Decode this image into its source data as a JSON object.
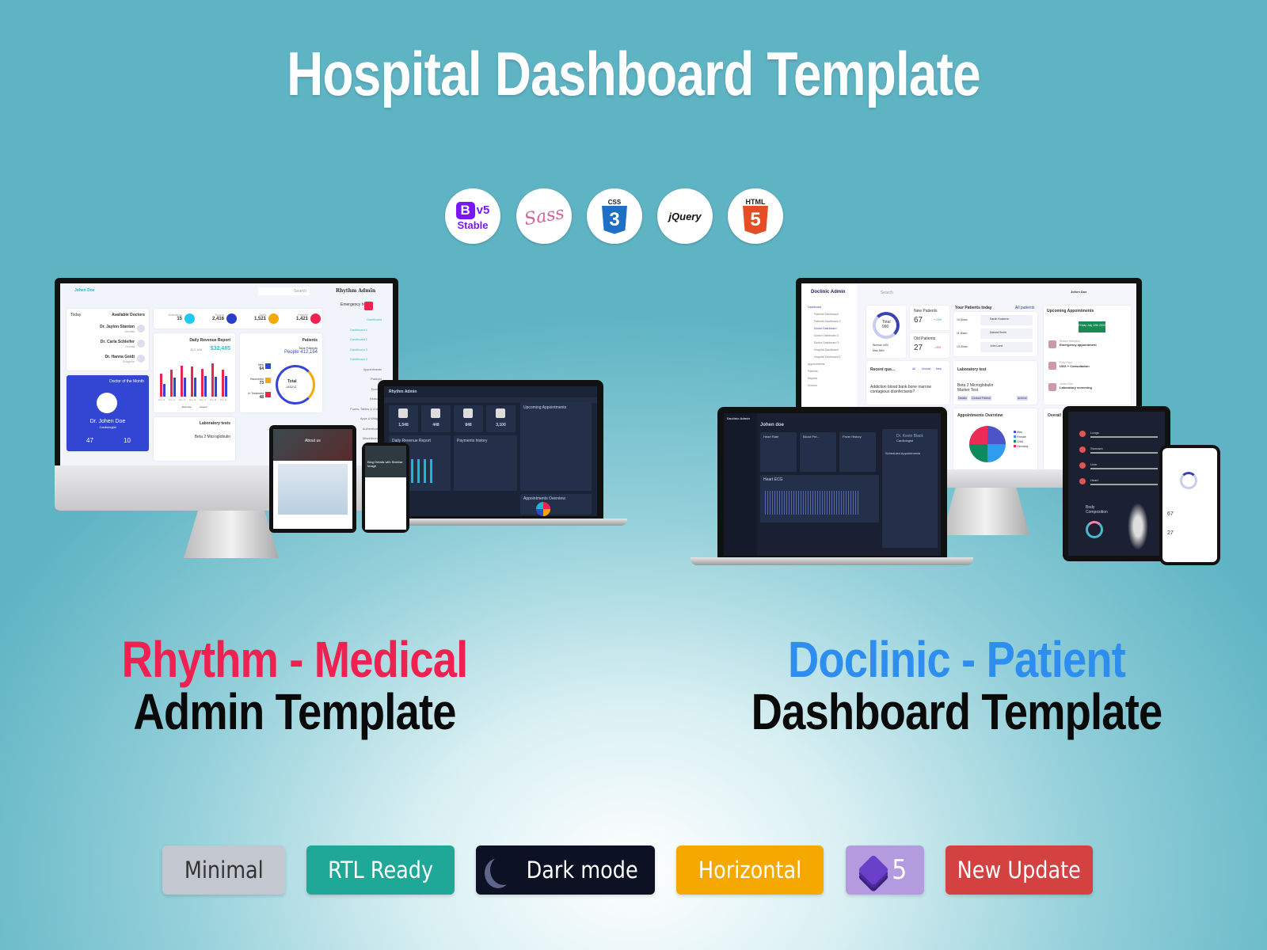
{
  "title": "Hospital Dashboard Template",
  "tech_icons": [
    {
      "name": "bootstrap-icon",
      "label": "B",
      "version": "v5",
      "sub": "Stable",
      "color": "#7a18f5"
    },
    {
      "name": "sass-icon",
      "label": "Sass",
      "color": "#cd6799"
    },
    {
      "name": "css3-icon",
      "label": "CSS",
      "num": "3",
      "color": "#1f6fc5"
    },
    {
      "name": "jquery-icon",
      "label": "jQuery",
      "color": "#0d0d0d"
    },
    {
      "name": "html5-icon",
      "label": "HTML",
      "num": "5",
      "color": "#e54d26"
    }
  ],
  "left_product": {
    "line1": "Rhythm - Medical",
    "line2": "Admin Template",
    "accent": "#ee2150"
  },
  "right_product": {
    "line1": "Doclinic - Patient",
    "line2": "Dashboard Template",
    "accent": "#2d8ef0"
  },
  "rhythm": {
    "brand": "Rhythm Admin",
    "user": "Johen Doe",
    "search": "Search",
    "stats": [
      {
        "label": "Ambulance",
        "value": "15",
        "color": "#1fc8f0"
      },
      {
        "label": "Rooms",
        "value": "2,416",
        "color": "#2a3fc9"
      },
      {
        "label": "Staffs",
        "value": "1,521",
        "color": "#f6a70a"
      },
      {
        "label": "Patients",
        "value": "1,421",
        "color": "#ec2451"
      }
    ],
    "available_doctors": "Available Doctors",
    "today": "Today",
    "doctors": [
      {
        "name": "Dr. Jaylon Stanton",
        "role": "Dentist"
      },
      {
        "name": "Dr. Carla Schleifer",
        "role": "Oculist"
      },
      {
        "name": "Dr. Hanna Geidt",
        "role": "Surgeon"
      }
    ],
    "revenue_title": "Daily Revenue Report",
    "revenue_old": "$12,458",
    "revenue": "$32,485",
    "revenue_days": [
      "May 10",
      "May 11",
      "May 12",
      "May 13",
      "May 14",
      "May 15",
      "May 16"
    ],
    "income": [
      70,
      82,
      92,
      90,
      84,
      100,
      80
    ],
    "expense": [
      38,
      56,
      58,
      57,
      62,
      59,
      63
    ],
    "legend": [
      "Expense",
      "Income"
    ],
    "patients_title": "Patients",
    "total_patients_label": "Total Patients",
    "total_patients": "People 412,154",
    "patient_stats": [
      {
        "label": "New",
        "value": "64"
      },
      {
        "label": "Recovered",
        "value": "73"
      },
      {
        "label": "In Treatment",
        "value": "48"
      }
    ],
    "donut_label": "Total",
    "donut_value": "145212",
    "dotm": "Doctor of the Month",
    "dotm_name": "Dr. Johen Doe",
    "dotm_role": "Cardiologist",
    "dotm_patients": "47",
    "dotm_patients_label": "Patients",
    "dotm_ops": "10",
    "dotm_ops_label": "Operations",
    "lab": "Laboratory tests",
    "lab_item": "Beta 2 Microglobulin",
    "emergency": "Emergency help",
    "menu": [
      "Dashboard",
      "Dashboard 1",
      "Dashboard 2",
      "Dashboard 3",
      "Dashboard 4",
      "Appointments",
      "Patients",
      "Doctors",
      "Features",
      "Forms, Tables & Charts",
      "Apps & Widgets",
      "Authentication",
      "Miscellaneous"
    ],
    "dark_stats": [
      "1,548",
      "448",
      "848",
      "3,100"
    ],
    "dark_titles": [
      "Daily Revenue Report",
      "Payments history",
      "Upcoming Appointments",
      "Appointments Overview"
    ],
    "tablet_text": "Blog Details with Sidebar Image",
    "tablet_head": "About us"
  },
  "doclinic": {
    "brand": "Doclinic Admin",
    "user": "Johen Doe",
    "search": "Search",
    "menu": [
      "Dashboard",
      "Patients Dashboard",
      "Patients Dashboard 2",
      "Doctor Dashboard",
      "Doctor Dashboard 2",
      "Doctor Dashboard 3",
      "Hospital Dashboard",
      "Hospital Dashboard 2",
      "Appointments",
      "Patients",
      "Reports",
      "Doctors"
    ],
    "total_label": "Total",
    "total": "990",
    "woman": "Woman 44%",
    "man": "Man 56%",
    "new_patients_label": "New Patients",
    "new_patients": "67",
    "new_change": "+ 24%",
    "old_patients_label": "Old Patients",
    "old_patients": "27",
    "old_change": "- 24%",
    "patients_today": "Your Patients today",
    "all_patients": "All patients",
    "today_list": [
      {
        "time": "10:30am",
        "name": "Sarah Hostemn"
      },
      {
        "time": "11:30am",
        "name": "Dakota Smith"
      },
      {
        "time": "13:30am",
        "name": "John Lane"
      }
    ],
    "upcoming": "Upcoming Appointments",
    "date_sel": "Friday July 12th 2024",
    "appointments": [
      {
        "name": "Shawn Hampton",
        "desc": "Emergency appointment"
      },
      {
        "name": "Polly Paul",
        "desc": "USG + Consultation"
      },
      {
        "name": "Johen Doe",
        "desc": "Laboratory screening"
      }
    ],
    "recent": "Recent que...",
    "question": "Addiction blood bank bone marrow contagious disinfectants?",
    "tabs": [
      "All",
      "Unread",
      "New"
    ],
    "lab": "Laboratory test",
    "lab_item": "Beta 2 Microglobulin",
    "lab_sub": "Marker Test",
    "lab_buttons": [
      "Details",
      "Contact Patient",
      "Archive"
    ],
    "overview": "Appointments Overview",
    "overview_legend": [
      "Man",
      "Female",
      "Child",
      "Germany"
    ],
    "overall": "Overall",
    "dark_name": "Johen doe",
    "dark_doctor": "Dr. Kevin Black",
    "dark_doctor_role": "Cardiologist",
    "dark_labels": [
      "Heart Rate",
      "Blood Pre...",
      "Fever History",
      "Scheduled Appointments",
      "Heart ECG"
    ],
    "body": "Body Composition",
    "organs": [
      "Lungs",
      "Stomach",
      "Liver",
      "Heart"
    ],
    "phone_new": "67",
    "phone_old": "27"
  },
  "badges": [
    {
      "label": "Minimal",
      "bg": "#c3c8d0",
      "fg": "#333"
    },
    {
      "label": "RTL Ready",
      "bg": "#1fa898",
      "fg": "#fff"
    },
    {
      "label": "Dark mode",
      "bg": "#0d1124",
      "fg": "#fff",
      "icon": "moon-icon"
    },
    {
      "label": "Horizontal",
      "bg": "#f4a800",
      "fg": "#fff"
    },
    {
      "label": "5",
      "bg": "#b49be0",
      "fg": "#fff",
      "icon": "bootstrap-stack-icon"
    },
    {
      "label": "New Update",
      "bg": "#d44141",
      "fg": "#fff"
    }
  ]
}
